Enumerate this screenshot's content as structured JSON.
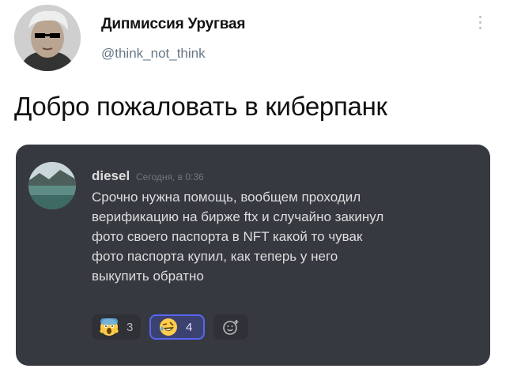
{
  "tweet": {
    "author_name": "Дипмиссия Уругвая",
    "handle": "@think_not_think",
    "text": "Добро пожаловать в киберпанк"
  },
  "embed": {
    "username": "diesel",
    "timestamp": "Сегодня, в 0:36",
    "message_lines": [
      "Срочно нужна помощь, вообщем проходил",
      "верификацию на бирже ftx и случайно закинул",
      "фото своего паспорта в NFT какой то чувак",
      "фото паспорта купил, как теперь у него",
      "выкупить обратно"
    ],
    "reactions": [
      {
        "emoji": "scream-emoji",
        "count": "3"
      },
      {
        "emoji": "rofl-emoji",
        "count": "4",
        "selected": true
      }
    ],
    "add_reaction_icon": "add-reaction-icon",
    "colors": {
      "background": "#36393f",
      "selected_reaction_border": "#5865f2"
    }
  }
}
